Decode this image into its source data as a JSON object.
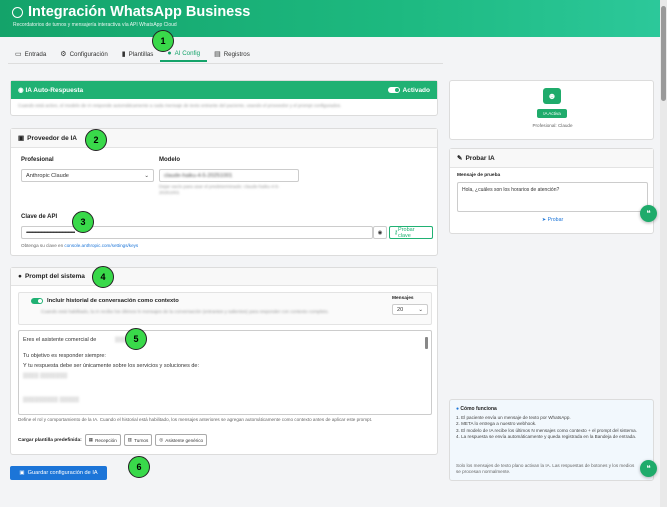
{
  "header": {
    "title": "Integración WhatsApp Business",
    "subtitle": "Recordatorios de turnos y mensajería interactiva vía API WhatsApp Cloud"
  },
  "tabs": [
    {
      "label": "Entrada",
      "icon": "inbox-icon"
    },
    {
      "label": "Configuración",
      "icon": "gear-icon"
    },
    {
      "label": "Plantillas",
      "icon": "file-icon"
    },
    {
      "label": "AI Config",
      "icon": "robot-icon",
      "active": true
    },
    {
      "label": "Registros",
      "icon": "list-icon"
    }
  ],
  "ia_auto": {
    "title": "IA Auto-Respuesta",
    "status": "Activado",
    "description": "Cuando está activo, el modelo de IA responde automáticamente a cada mensaje de texto entrante del paciente, usando el proveedor y el prompt configurados."
  },
  "proveedor": {
    "title": "Proveedor de IA",
    "profesional_label": "Profesional",
    "profesional_value": "Anthropic Claude",
    "modelo_label": "Modelo",
    "modelo_value": "claude-haiku-4-5-20251001",
    "modelo_help": "Dejar vacío para usar el predeterminado: claude-haiku-4-5-20251001",
    "api_label": "Clave de API",
    "api_value": "•••••••••••••••••••••••••••••••••••••••••••••••••••••••••••••••••",
    "api_test_button": "Probar clave",
    "api_help_prefix": "Obtenga su clave en",
    "api_help_link": "console.anthropic.com/settings/keys"
  },
  "prompt": {
    "title": "Prompt del sistema",
    "history_label": "Incluir historial de conversación como contexto",
    "history_help": "Cuando está habilitado, la IA recibe los últimos N mensajes de la conversación (entrantes y salientes) para responder con contexto completo.",
    "mensajes_label": "Mensajes",
    "mensajes_value": "20",
    "text_line1": "Eres el asistente comercial de",
    "text_line2": "Tu objetivo es responder siempre:",
    "text_line3": "Y tu respuesta debe ser únicamente sobre los servicios y soluciones de:",
    "help": "Define el rol y comportamiento de la IA. Cuando el historial está habilitado, los mensajes anteriores se agregan automáticamente como contexto antes de aplicar este prompt.",
    "template_label": "Cargar plantilla predefinida:",
    "templates": [
      "Recepción",
      "Turnos",
      "Asistente genérico"
    ]
  },
  "save_button": "Guardar configuración de IA",
  "status_card": {
    "badge": "IA Activa",
    "provider": "Profesional: Claude"
  },
  "probar": {
    "title": "Probar IA",
    "label": "Mensaje de prueba",
    "value": "Hola, ¿cuáles son los horarios de atención?",
    "button": "Probar"
  },
  "como": {
    "title": "Cómo funciona",
    "steps": [
      "1. El paciente envía un mensaje de texto por WhatsApp.",
      "2. META lo entrega a nuestro webhook.",
      "3. El modelo de IA recibe los últimos N mensajes como contexto + el prompt del sistema.",
      "4. La respuesta se envía automáticamente y queda registrada en la Bandeja de entrada."
    ],
    "note": "Solo los mensajes de texto plano activan la IA. Las respuestas de botones y los medios se procesan normalmente."
  },
  "annotations": [
    "1",
    "2",
    "3",
    "4",
    "5",
    "6"
  ],
  "colors": {
    "brand": "#14a36a",
    "primary": "#1c75d8",
    "marker": "#39d94a"
  }
}
